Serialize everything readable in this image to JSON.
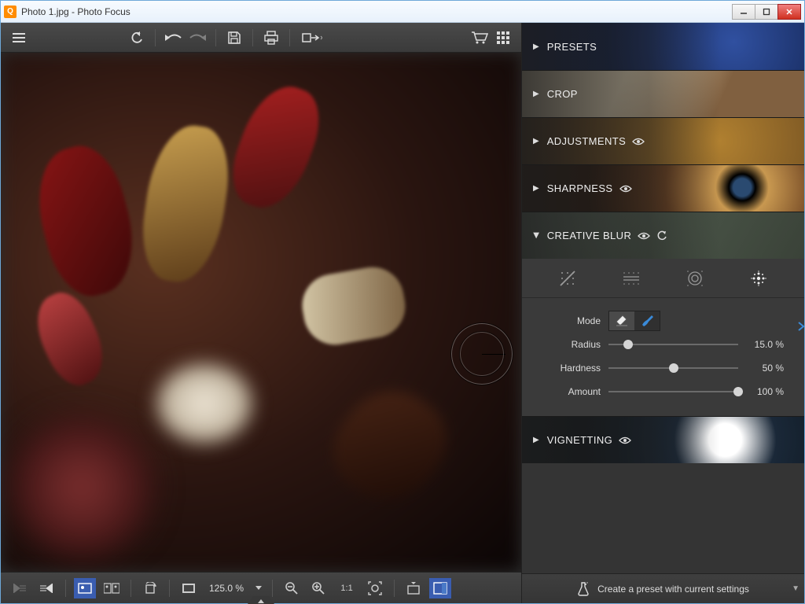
{
  "titlebar": {
    "text": "Photo 1.jpg - Photo Focus",
    "icon_letter": "Q"
  },
  "toolbar": {
    "menu": "menu",
    "undo_all": "undo-all",
    "undo": "undo",
    "redo": "redo",
    "save": "save",
    "print": "print",
    "export": "export",
    "cart": "cart",
    "grid": "grid-view"
  },
  "bottombar": {
    "prev": "prev",
    "next": "next",
    "compare_a": "compare-single",
    "compare_b": "compare-split",
    "rotate": "rotate",
    "fit": "fit-screen",
    "zoom_value": "125.0 %",
    "zoom_out": "zoom-out",
    "zoom_in": "zoom-in",
    "one_to_one": "1:1",
    "fit_zoom": "fit-zoom",
    "histogram": "histogram",
    "info": "info"
  },
  "panels": {
    "presets": {
      "label": "PRESETS",
      "expanded": false
    },
    "crop": {
      "label": "CROP",
      "expanded": false
    },
    "adjustments": {
      "label": "ADJUSTMENTS",
      "expanded": false,
      "eye": true
    },
    "sharpness": {
      "label": "SHARPNESS",
      "expanded": false,
      "eye": true
    },
    "creative_blur": {
      "label": "CREATIVE BLUR",
      "expanded": true,
      "eye": true,
      "undo": true,
      "brush_types": [
        "none",
        "linear",
        "radial",
        "custom"
      ],
      "brush_active": "custom",
      "mode_label": "Mode",
      "mode_active": "erase",
      "sliders": {
        "radius": {
          "label": "Radius",
          "value": 15.0,
          "display": "15.0 %"
        },
        "hardness": {
          "label": "Hardness",
          "value": 50,
          "display": "50 %"
        },
        "amount": {
          "label": "Amount",
          "value": 100,
          "display": "100 %"
        }
      }
    },
    "vignetting": {
      "label": "VIGNETTING",
      "expanded": false,
      "eye": true
    }
  },
  "preset_bar": {
    "label": "Create a preset with current settings"
  }
}
